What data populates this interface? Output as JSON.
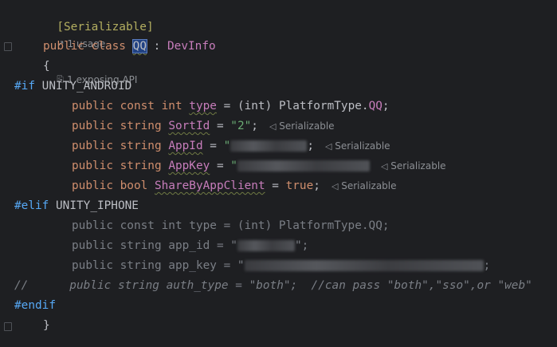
{
  "editor": {
    "annotation": "[Serializable]",
    "usages": {
      "usage_label": "1 usage",
      "api_label": "1 exposing API"
    },
    "class_decl": {
      "public": "public",
      "class": "class",
      "name": "QQ",
      "colon": ":",
      "base": "DevInfo"
    },
    "open_brace": "{",
    "close_brace": "}",
    "if_directive": "#if",
    "if_symbol": "UNITY_ANDROID",
    "elif_directive": "#elif",
    "elif_symbol": "UNITY_IPHONE",
    "endif_directive": "#endif",
    "android_fields": [
      {
        "mods": "public const int",
        "name": "type",
        "rest_a": " = (int) ",
        "rest_b": "PlatformType.",
        "rest_c": "QQ",
        "rest_d": ";",
        "hint": ""
      },
      {
        "mods": "public string",
        "name": "SortId",
        "rest_a": " = ",
        "value": "\"2\"",
        "end": ";",
        "hint": "Serializable"
      },
      {
        "mods": "public string",
        "name": "AppId",
        "rest_a": " = ",
        "value": "\"",
        "end": ";",
        "hint": "Serializable"
      },
      {
        "mods": "public string",
        "name": "AppKey",
        "rest_a": " = ",
        "value": "\"",
        "end": "",
        "hint": "Serializable"
      },
      {
        "mods": "public bool",
        "name": "ShareByAppClient",
        "rest_a": " = ",
        "value": "true",
        "end": ";",
        "hint": "Serializable"
      }
    ],
    "iphone_lines": [
      "public const int type = (int) PlatformType.QQ;",
      "public string app_id = \"",
      "public string app_key = \"",
      "//      public string auth_type = \"both\";  //can pass \"both\",\"sso\",or \"web\""
    ],
    "iphone_tail_1": "\";",
    "iphone_tail_2": ";"
  }
}
